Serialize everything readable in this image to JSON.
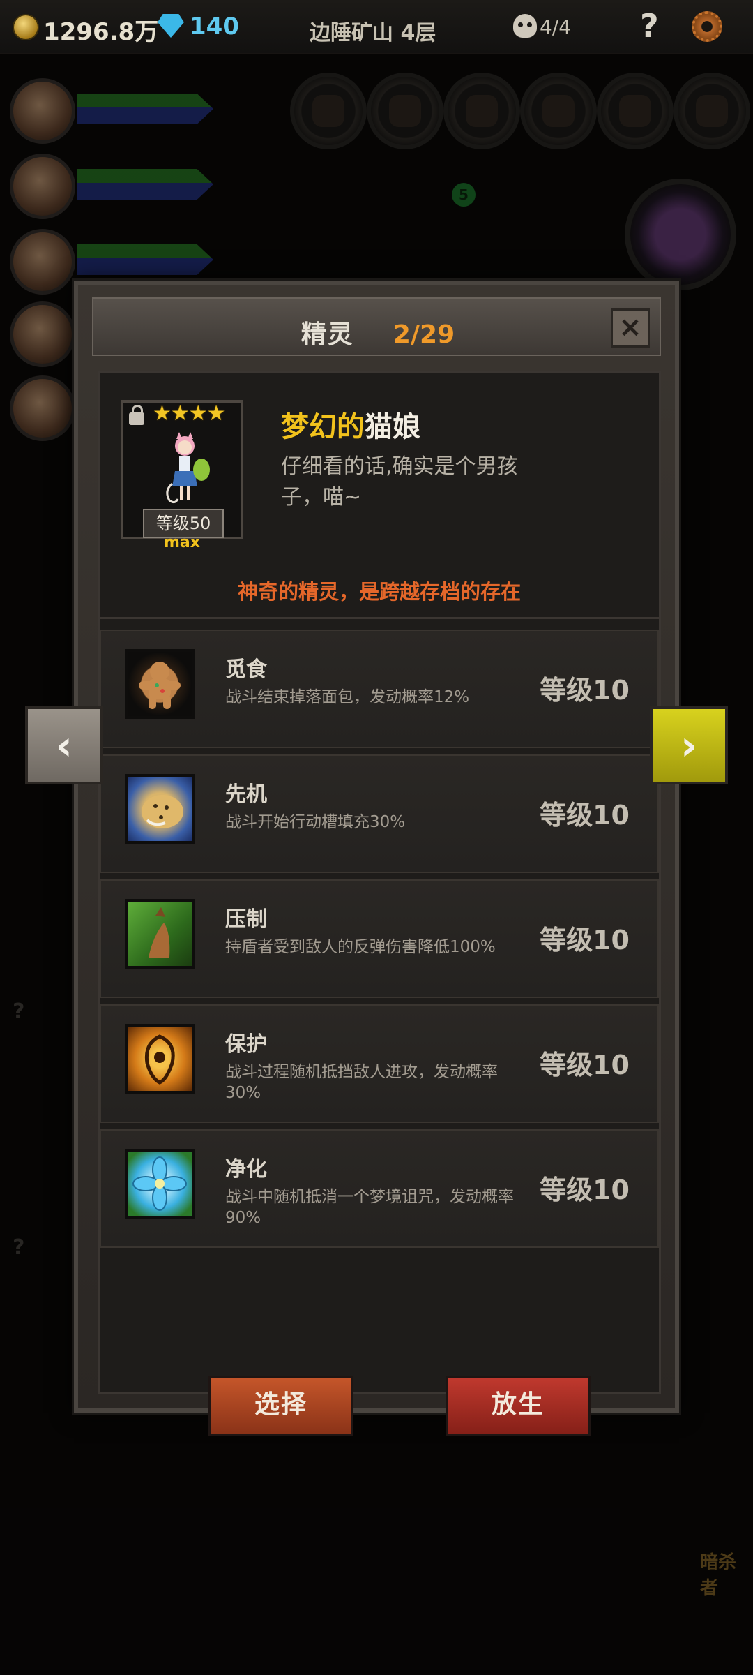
{
  "hud": {
    "gold": "1296.8万",
    "gems": "140",
    "location": "边陲矿山 4层",
    "kills": "4/4",
    "help": "?",
    "icons": [
      "coin-icon",
      "gem-icon",
      "skull-icon",
      "help-icon",
      "gear-icon"
    ]
  },
  "background": {
    "green_badge": "5",
    "side_marks": [
      "?",
      "?"
    ],
    "enemy_label": "暗杀者"
  },
  "modal": {
    "title": "精灵",
    "count": "2/29",
    "close_icon": "×",
    "pet": {
      "stars": "★★★★",
      "level": "等级50",
      "max": "max",
      "name_part1": "梦幻的",
      "name_part2": "猫娘",
      "description": "仔细看的话,确实是个男孩子，喵~",
      "tagline": "神奇的精灵，是跨越存档的存在"
    },
    "skills": [
      {
        "name": "觅食",
        "desc": "战斗结束掉落面包，发动概率12%",
        "level": "等级10",
        "icon": "gingerbread-icon"
      },
      {
        "name": "先机",
        "desc": "战斗开始行动槽填充30%",
        "level": "等级10",
        "icon": "leopard-icon"
      },
      {
        "name": "压制",
        "desc": "持盾者受到敌人的反弹伤害降低100%",
        "level": "等级10",
        "icon": "claw-icon"
      },
      {
        "name": "保护",
        "desc": "战斗过程随机抵挡敌人进攻，发动概率30%",
        "level": "等级10",
        "icon": "shield-spirit-icon"
      },
      {
        "name": "净化",
        "desc": "战斗中随机抵消一个梦境诅咒，发动概率90%",
        "level": "等级10",
        "icon": "blue-flower-icon"
      }
    ],
    "prev_arrow": "‹",
    "next_arrow": "›",
    "select_label": "选择",
    "release_label": "放生"
  },
  "colors": {
    "accent_orange": "#f09a2a",
    "name_gold": "#f2c21c",
    "tagline_orange": "#e5672a",
    "next_arrow_yellow": "#d8d21e",
    "select_button": "#c5562a",
    "release_button": "#c0392e"
  }
}
